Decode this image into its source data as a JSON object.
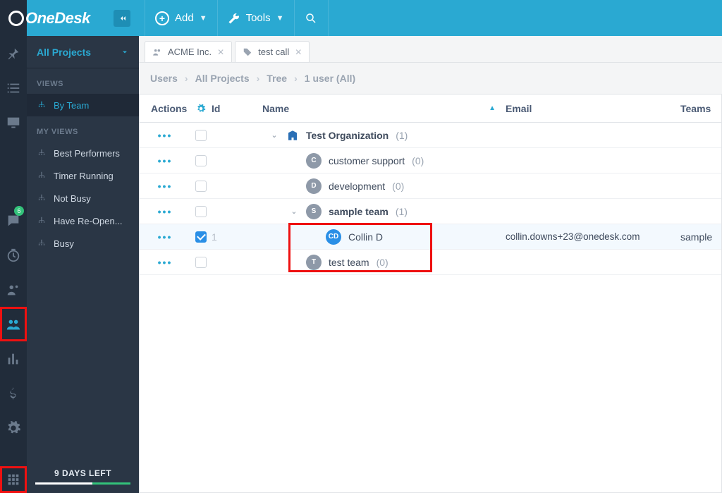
{
  "brand": "OneDesk",
  "topbar": {
    "add_label": "Add",
    "tools_label": "Tools"
  },
  "rail": {
    "badge_messages": "6"
  },
  "sidebar": {
    "projects_label": "All Projects",
    "views_heading": "VIEWS",
    "views": [
      {
        "label": "By Team",
        "active": true
      }
    ],
    "myviews_heading": "MY VIEWS",
    "myviews": [
      {
        "label": "Best Performers"
      },
      {
        "label": "Timer Running"
      },
      {
        "label": "Not Busy"
      },
      {
        "label": "Have Re-Open..."
      },
      {
        "label": "Busy"
      }
    ],
    "trial_text": "9 DAYS LEFT"
  },
  "tabs": [
    {
      "label": "ACME Inc."
    },
    {
      "label": "test call"
    }
  ],
  "breadcrumb": [
    "Users",
    "All Projects",
    "Tree",
    "1 user (All)"
  ],
  "columns": {
    "actions": "Actions",
    "id": "Id",
    "name": "Name",
    "email": "Email",
    "teams": "Teams"
  },
  "rows": [
    {
      "type": "org",
      "indent": 0,
      "expand": "open",
      "icon": "org",
      "name": "Test Organization",
      "count": "(1)",
      "bold": true
    },
    {
      "type": "team",
      "indent": 1,
      "avatar": "C",
      "name": "customer support",
      "count": "(0)"
    },
    {
      "type": "team",
      "indent": 1,
      "avatar": "D",
      "name": "development",
      "count": "(0)"
    },
    {
      "type": "team",
      "indent": 1,
      "expand": "open",
      "avatar": "S",
      "name": "sample team",
      "count": "(1)",
      "bold": true
    },
    {
      "type": "user",
      "indent": 2,
      "selected": true,
      "id_dim": "1",
      "avatar": "CD",
      "avatar_kind": "blue",
      "name": "Collin D",
      "email": "collin.downs+23@onedesk.com",
      "teams": "sample"
    },
    {
      "type": "team",
      "indent": 1,
      "avatar": "T",
      "name": "test team",
      "count": "(0)"
    }
  ]
}
